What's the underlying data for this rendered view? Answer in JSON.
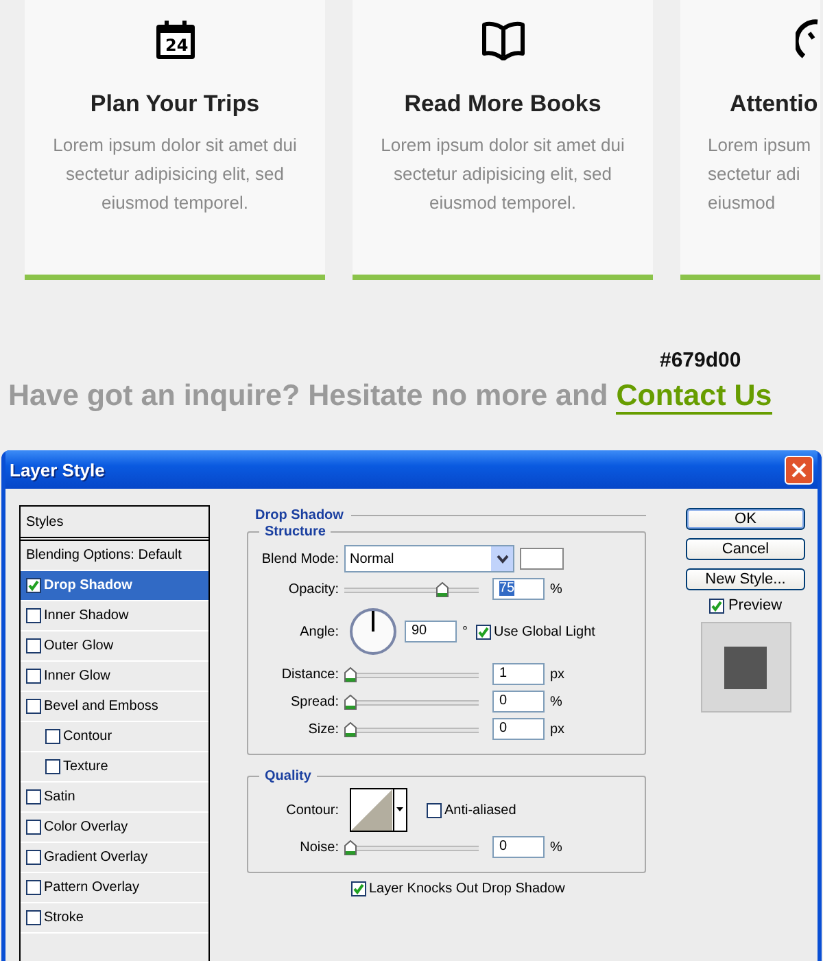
{
  "cards": [
    {
      "kind": "calendar",
      "icon_text": "24",
      "title": "Plan Your Trips",
      "description": "Lorem ipsum dolor sit amet dui sectetur adipisicing elit, sed eiusmod temporel."
    },
    {
      "kind": "book",
      "title": "Read More Books",
      "description": "Lorem ipsum dolor sit amet dui sectetur adipisicing elit, sed eiusmod temporel."
    },
    {
      "kind": "gauge",
      "title": "Attentio",
      "description": "Lorem ipsum sectetur adi eiusmod"
    }
  ],
  "inquiry": {
    "color_label": "#679d00",
    "text": "Have got an inquire? Hesitate no more and",
    "link": "Contact Us"
  },
  "dialog": {
    "title": "Layer Style",
    "styles_header": "Styles",
    "styles": [
      {
        "kind": "plain",
        "label": "Blending Options: Default",
        "selected": false
      },
      {
        "kind": "checkbox",
        "label": "Drop Shadow",
        "checked": true,
        "selected": true
      },
      {
        "kind": "checkbox",
        "label": "Inner Shadow",
        "checked": false,
        "selected": false
      },
      {
        "kind": "checkbox",
        "label": "Outer Glow",
        "checked": false,
        "selected": false
      },
      {
        "kind": "checkbox",
        "label": "Inner Glow",
        "checked": false,
        "selected": false
      },
      {
        "kind": "checkbox",
        "label": "Bevel and Emboss",
        "checked": false,
        "selected": false,
        "children": [
          {
            "kind": "checkbox",
            "label": "Contour",
            "checked": false,
            "selected": false
          },
          {
            "kind": "checkbox",
            "label": "Texture",
            "checked": false,
            "selected": false
          }
        ]
      },
      {
        "kind": "checkbox",
        "label": "Satin",
        "checked": false,
        "selected": false
      },
      {
        "kind": "checkbox",
        "label": "Color Overlay",
        "checked": false,
        "selected": false
      },
      {
        "kind": "checkbox",
        "label": "Gradient Overlay",
        "checked": false,
        "selected": false
      },
      {
        "kind": "checkbox",
        "label": "Pattern Overlay",
        "checked": false,
        "selected": false
      },
      {
        "kind": "checkbox",
        "label": "Stroke",
        "checked": false,
        "selected": false
      }
    ],
    "section_title": "Drop Shadow",
    "structure": {
      "title": "Structure",
      "rows": [
        {
          "kind": "select",
          "label": "Blend Mode:",
          "value": "Normal"
        },
        {
          "kind": "slider",
          "label": "Opacity:",
          "level": 0.75,
          "value": "75",
          "unit": "%",
          "highlighted": true
        },
        {
          "kind": "angle",
          "label": "Angle:",
          "value": "90",
          "unit": "°",
          "option": {
            "label": "Use Global Light",
            "checked": true
          }
        },
        {
          "kind": "slider",
          "label": "Distance:",
          "level": 0,
          "value": "1",
          "unit": "px",
          "highlighted": false
        },
        {
          "kind": "slider",
          "label": "Spread:",
          "level": 0,
          "value": "0",
          "unit": "%",
          "highlighted": false
        },
        {
          "kind": "slider",
          "label": "Size:",
          "level": 0,
          "value": "0",
          "unit": "px",
          "highlighted": false
        }
      ]
    },
    "quality": {
      "title": "Quality",
      "rows": [
        {
          "kind": "contour",
          "label": "Contour:",
          "option": {
            "label": "Anti-aliased",
            "checked": false
          }
        },
        {
          "kind": "slider",
          "label": "Noise:",
          "level": 0,
          "value": "0",
          "unit": "%",
          "highlighted": false
        }
      ]
    },
    "knockout": {
      "label": "Layer Knocks Out Drop Shadow",
      "checked": true
    },
    "buttons": [
      {
        "label": "OK",
        "default": true
      },
      {
        "label": "Cancel",
        "default": false
      },
      {
        "label": "New Style...",
        "default": false
      }
    ],
    "preview": {
      "label": "Preview",
      "checked": true
    }
  }
}
